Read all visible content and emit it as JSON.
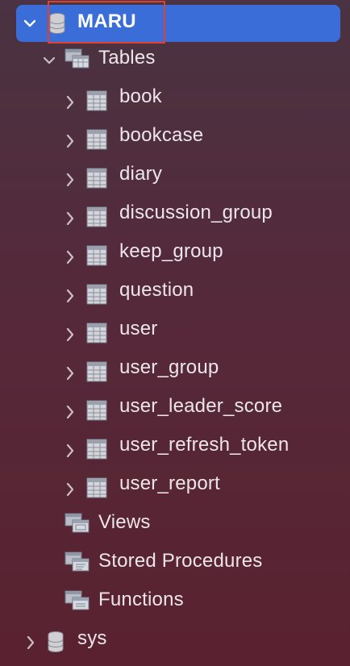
{
  "tree": {
    "database_selected": {
      "label": "MARU",
      "expanded": true
    },
    "tables_folder": {
      "label": "Tables",
      "expanded": true
    },
    "tables": [
      {
        "label": "book"
      },
      {
        "label": "bookcase"
      },
      {
        "label": "diary"
      },
      {
        "label": "discussion_group"
      },
      {
        "label": "keep_group"
      },
      {
        "label": "question"
      },
      {
        "label": "user"
      },
      {
        "label": "user_group"
      },
      {
        "label": "user_leader_score"
      },
      {
        "label": "user_refresh_token"
      },
      {
        "label": "user_report"
      }
    ],
    "views_folder": {
      "label": "Views"
    },
    "procedures_folder": {
      "label": "Stored Procedures"
    },
    "functions_folder": {
      "label": "Functions"
    },
    "database_other": {
      "label": "sys",
      "expanded": false
    }
  },
  "colors": {
    "selection": "#3a6dd8",
    "annotation_box": "#e0402f"
  }
}
